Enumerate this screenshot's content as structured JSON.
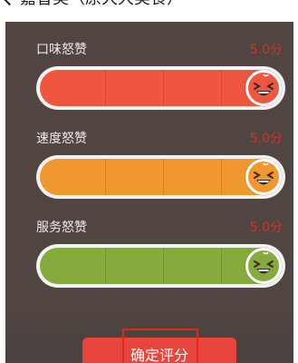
{
  "header": {
    "title": "嘉香美（原大大美食）"
  },
  "ratings": [
    {
      "label": "口味怒赞",
      "score": "5.0分",
      "level": 1.0,
      "color": "#ef5640",
      "line_color": "#d9432f"
    },
    {
      "label": "速度怒赞",
      "score": "5.0分",
      "level": 1.0,
      "color": "#f0982f",
      "line_color": "#d8831f"
    },
    {
      "label": "服务怒赞",
      "score": "5.0分",
      "level": 1.0,
      "color": "#86aa3c",
      "line_color": "#72952e"
    }
  ],
  "submit": {
    "label": "确定评分"
  },
  "colors": {
    "panel": "#514541",
    "score_text": "#c8372d",
    "button": "#e8453c",
    "highlight": "#e0281f"
  },
  "icons": {
    "back": "chevron-left-icon",
    "face": "laughing-face-icon"
  }
}
